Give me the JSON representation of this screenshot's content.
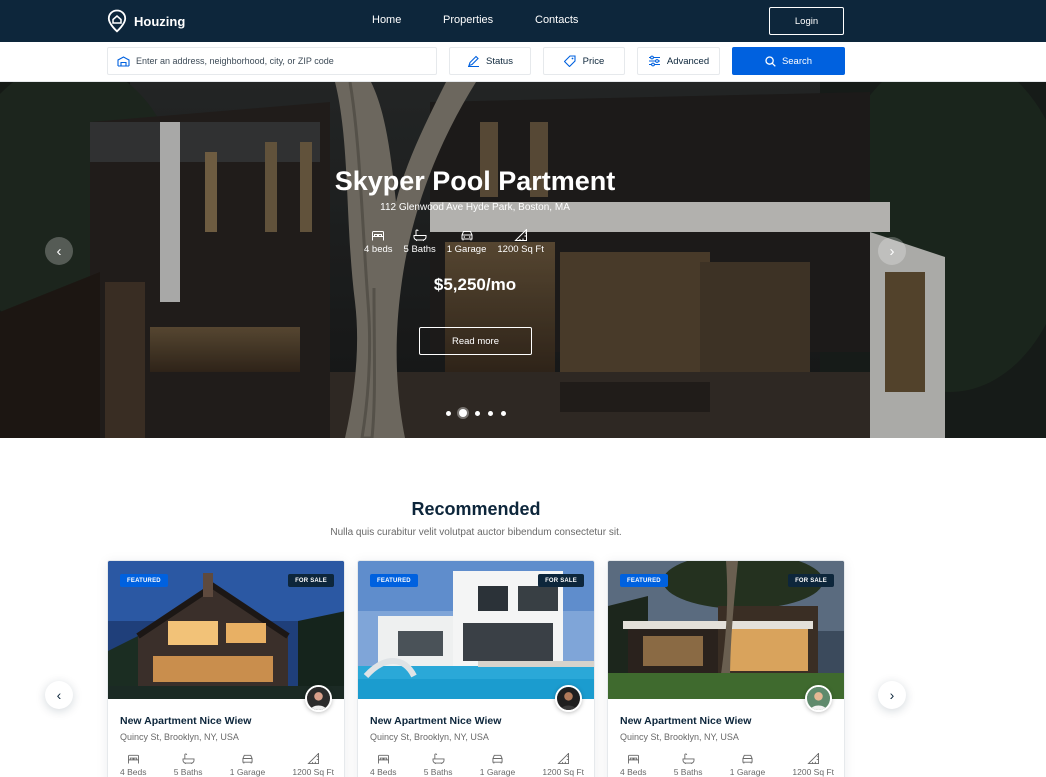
{
  "brand": {
    "name": "Houzing"
  },
  "nav": {
    "links": [
      "Home",
      "Properties",
      "Contacts"
    ],
    "login": "Login"
  },
  "search": {
    "placeholder": "Enter an address, neighborhood, city, or ZIP code",
    "status": "Status",
    "price": "Price",
    "advanced": "Advanced",
    "search": "Search"
  },
  "hero": {
    "title": "Skyper Pool Partment",
    "address": "112 Glenwood Ave Hyde Park, Boston, MA",
    "features": {
      "beds": "4 beds",
      "baths": "5 Baths",
      "garage": "1 Garage",
      "area": "1200 Sq Ft"
    },
    "price": "$5,250/mo",
    "cta": "Read more",
    "slides_total": 5,
    "active_slide": 2
  },
  "recommended": {
    "title": "Recommended",
    "subtitle": "Nulla quis curabitur velit volutpat auctor bibendum consectetur sit.",
    "cards": [
      {
        "featured": "FEATURED",
        "status": "FOR SALE",
        "title": "New Apartment Nice Wiew",
        "address": "Quincy St, Brooklyn, NY, USA",
        "beds": "4 Beds",
        "baths": "5 Baths",
        "garage": "1 Garage",
        "area": "1200 Sq Ft"
      },
      {
        "featured": "FEATURED",
        "status": "FOR SALE",
        "title": "New Apartment Nice Wiew",
        "address": "Quincy St, Brooklyn, NY, USA",
        "beds": "4 Beds",
        "baths": "5 Baths",
        "garage": "1 Garage",
        "area": "1200 Sq Ft"
      },
      {
        "featured": "FEATURED",
        "status": "FOR SALE",
        "title": "New Apartment Nice Wiew",
        "address": "Quincy St, Brooklyn, NY, USA",
        "beds": "4 Beds",
        "baths": "5 Baths",
        "garage": "1 Garage",
        "area": "1200 Sq Ft"
      }
    ]
  },
  "colors": {
    "navy": "#0d263b",
    "primary": "#0061df",
    "muted": "#696969",
    "border": "#e6e9ec"
  },
  "icons": {
    "brand": "map-pin-house-icon",
    "search_input": "building-icon",
    "status": "pen-icon",
    "price": "tag-icon",
    "advanced": "sliders-icon",
    "search": "search-icon",
    "bed": "bed-icon",
    "bath": "bath-icon",
    "garage": "car-icon",
    "area": "ruler-icon",
    "prev": "chevron-left-icon",
    "next": "chevron-right-icon"
  }
}
